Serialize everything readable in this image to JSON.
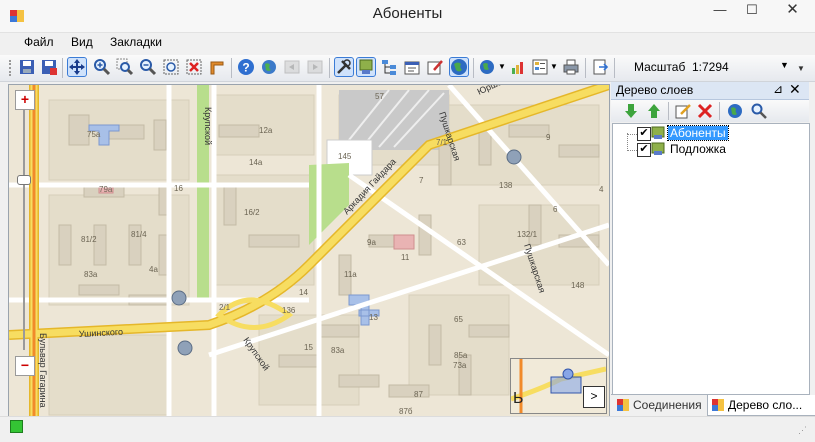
{
  "window": {
    "title": "Абоненты",
    "minimize_glyph": "—",
    "maximize_glyph": "☐",
    "close_glyph": "✕"
  },
  "menu": [
    "Файл",
    "Вид",
    "Закладки"
  ],
  "toolbar": {
    "icons": [
      "save-icon",
      "save-as-icon",
      "pan-icon",
      "zoom-in-icon",
      "zoom-window-icon",
      "zoom-out-icon",
      "zoom-extent-icon",
      "clear-selection-icon",
      "measure-icon",
      "help-icon",
      "globe-icon",
      "back-icon",
      "forward-icon",
      "tools-icon",
      "layer-edit-icon",
      "tree-icon",
      "properties-icon",
      "edit-object-icon",
      "world-map-icon",
      "globe-dropdown-icon",
      "chart-icon",
      "legend-icon",
      "print-icon",
      "export-icon"
    ],
    "scale_label": "Масштаб",
    "scale_value": "1:7294"
  },
  "map": {
    "zoom_in": "+",
    "zoom_out": "−",
    "street_labels": [
      "Пушкарская",
      "Юрша",
      "Аркадия Гайдара",
      "Крупской",
      "Ушинского",
      "Бульвар Гагарина",
      "Пушкарская",
      "Крупской"
    ],
    "building_labels": [
      "75а",
      "12а",
      "14а",
      "79а",
      "16",
      "16/2",
      "81/2",
      "81/4",
      "4а",
      "83а",
      "2/1",
      "14",
      "9а",
      "11",
      "11а",
      "13",
      "15",
      "83а",
      "85а",
      "73а",
      "57",
      "145",
      "7/1",
      "7",
      "63",
      "132/1",
      "138",
      "136",
      "65",
      "87",
      "87б",
      "148",
      "6",
      "4",
      "9"
    ],
    "minimap_arrow": ">"
  },
  "colors": {
    "map_background": "#ede6d6",
    "main_road": "#f4d64a",
    "secondary_road": "#ffffff",
    "park": "#b8de8c",
    "building": "#ddd5c2",
    "selection": "#3399ff"
  },
  "layer_panel": {
    "title": "Дерево слоев",
    "pin_glyph": "📌",
    "close_glyph": "✕",
    "toolbar_icons": [
      "move-down-icon",
      "move-up-icon",
      "edit-layer-icon",
      "delete-layer-icon",
      "add-layer-icon",
      "search-layer-icon"
    ],
    "layers": [
      {
        "name": "Абоненты",
        "checked": true,
        "selected": true
      },
      {
        "name": "Подложка",
        "checked": true,
        "selected": false
      }
    ],
    "tabs": [
      "Соединения",
      "Дерево сло..."
    ]
  }
}
